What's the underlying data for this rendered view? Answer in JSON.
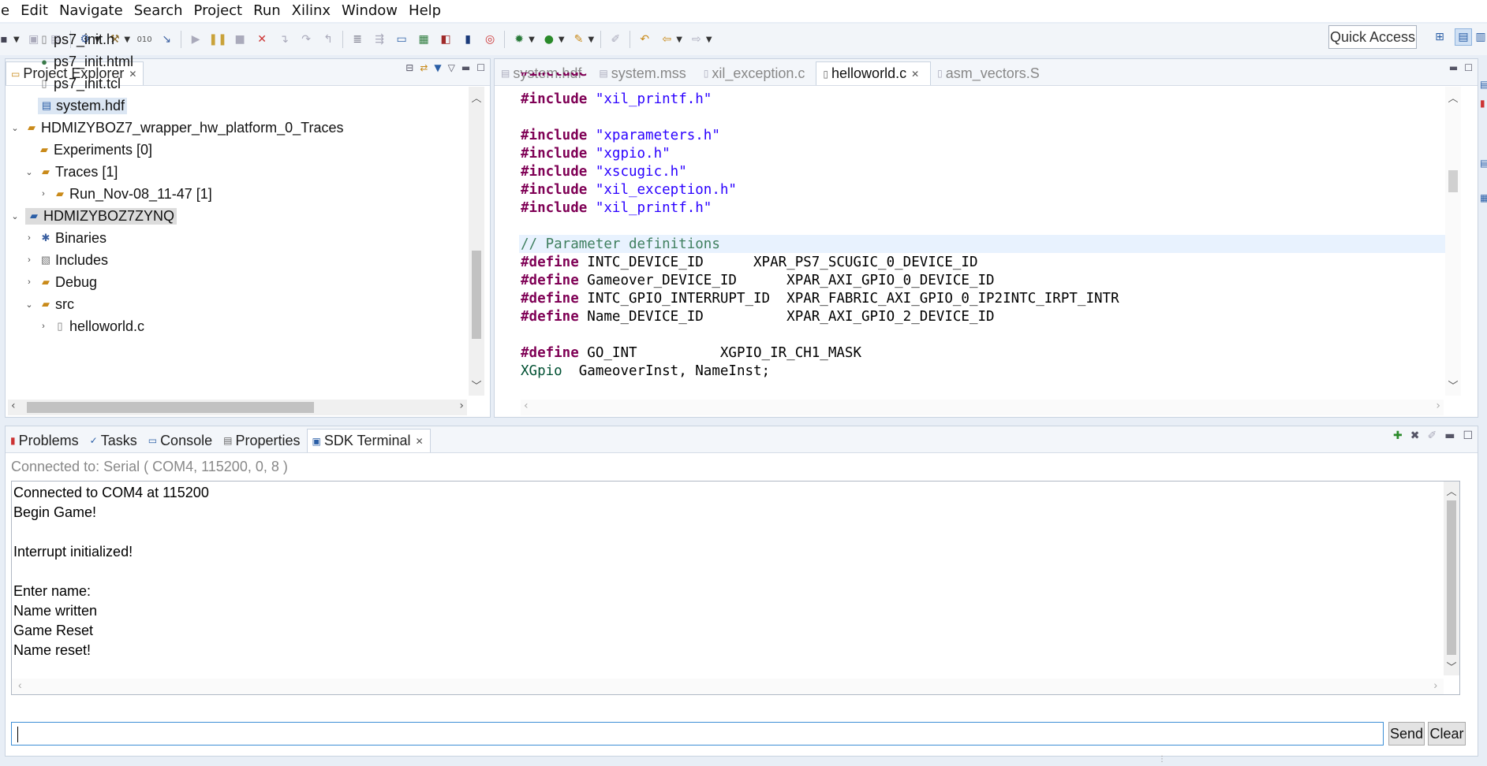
{
  "menu": [
    "le",
    "Edit",
    "Navigate",
    "Search",
    "Project",
    "Run",
    "Xilinx",
    "Window",
    "Help"
  ],
  "quick_access": "Quick Access",
  "explorer": {
    "title": "Project Explorer",
    "items": [
      {
        "label": "ps7_init.h"
      },
      {
        "label": "ps7_init.html"
      },
      {
        "label": "ps7_init.tcl"
      },
      {
        "label": "system.hdf"
      },
      {
        "label": "HDMIZYBOZ7_wrapper_hw_platform_0_Traces"
      },
      {
        "label": "Experiments [0]"
      },
      {
        "label": "Traces [1]"
      },
      {
        "label": "Run_Nov-08_11-47 [1]"
      },
      {
        "label": "HDMIZYBOZ7ZYNQ"
      },
      {
        "label": "Binaries"
      },
      {
        "label": "Includes"
      },
      {
        "label": "Debug"
      },
      {
        "label": "src"
      },
      {
        "label": "helloworld.c"
      }
    ]
  },
  "editor": {
    "tabs": [
      {
        "label": "system.hdf"
      },
      {
        "label": "system.mss"
      },
      {
        "label": "xil_exception.c"
      },
      {
        "label": "helloworld.c"
      },
      {
        "label": "asm_vectors.S"
      }
    ],
    "code": {
      "l1": {
        "kw": "#include",
        "str": "\"xil_printf.h\""
      },
      "l3": {
        "kw": "#include",
        "str": "\"xparameters.h\""
      },
      "l4": {
        "kw": "#include",
        "str": "\"xgpio.h\""
      },
      "l5": {
        "kw": "#include",
        "str": "\"xscugic.h\""
      },
      "l6": {
        "kw": "#include",
        "str": "\"xil_exception.h\""
      },
      "l7": {
        "kw": "#include",
        "str": "\"xil_printf.h\""
      },
      "l9": {
        "cmt": "// Parameter definitions"
      },
      "l10": {
        "kw": "#define",
        "rest": " INTC_DEVICE_ID      XPAR_PS7_SCUGIC_0_DEVICE_ID"
      },
      "l11": {
        "kw": "#define",
        "rest": " Gameover_DEVICE_ID      XPAR_AXI_GPIO_0_DEVICE_ID"
      },
      "l12": {
        "kw": "#define",
        "rest": " INTC_GPIO_INTERRUPT_ID  XPAR_FABRIC_AXI_GPIO_0_IP2INTC_IRPT_INTR"
      },
      "l13": {
        "kw": "#define",
        "rest": " Name_DEVICE_ID          XPAR_AXI_GPIO_2_DEVICE_ID"
      },
      "l15": {
        "kw": "#define",
        "rest": " GO_INT          XGPIO_IR_CH1_MASK"
      },
      "l17": {
        "typ": "XGpio",
        "rest": "  GameoverInst, NameInst;"
      }
    }
  },
  "bottom": {
    "tabs": [
      {
        "label": "Problems"
      },
      {
        "label": "Tasks"
      },
      {
        "label": "Console"
      },
      {
        "label": "Properties"
      },
      {
        "label": "SDK Terminal"
      }
    ],
    "connection_status": "Connected to: Serial (  COM4, 115200, 0, 8 )",
    "terminal_lines": [
      "Connected to COM4 at 115200",
      "Begin Game!",
      "",
      "Interrupt initialized!",
      "",
      "Enter name:",
      "Name written",
      "Game Reset",
      "Name reset!"
    ],
    "send_label": "Send",
    "clear_label": "Clear"
  }
}
